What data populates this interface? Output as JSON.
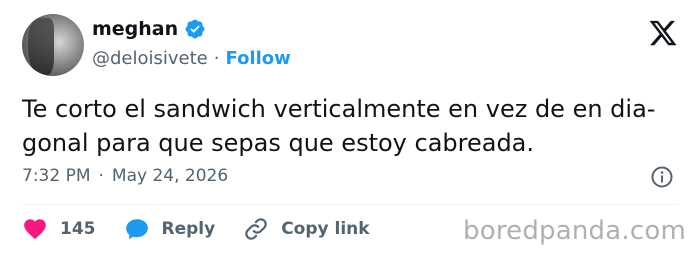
{
  "user": {
    "display_name": "meghan",
    "handle": "@deloisivete",
    "separator": "·",
    "follow_label": "Follow"
  },
  "tweet": {
    "text_line1": "Te corto el sandwich verticalmente en vez de en dia-",
    "text_line2": "gonal para que sepas que estoy cabreada.",
    "time": "7:32 PM",
    "meta_separator": "·",
    "date": "May 24, 2026"
  },
  "actions": {
    "like_count": "145",
    "reply_label": "Reply",
    "copy_link_label": "Copy link"
  },
  "watermark": "boredpanda.com",
  "colors": {
    "accent": "#1d9bf0",
    "like": "#f91880",
    "text": "#0f1419",
    "muted": "#536471"
  },
  "icons": {
    "verified": "verified-badge-icon",
    "brand": "x-logo-icon",
    "info": "info-icon",
    "like": "heart-icon",
    "reply": "reply-bubble-icon",
    "copy_link": "link-icon"
  }
}
